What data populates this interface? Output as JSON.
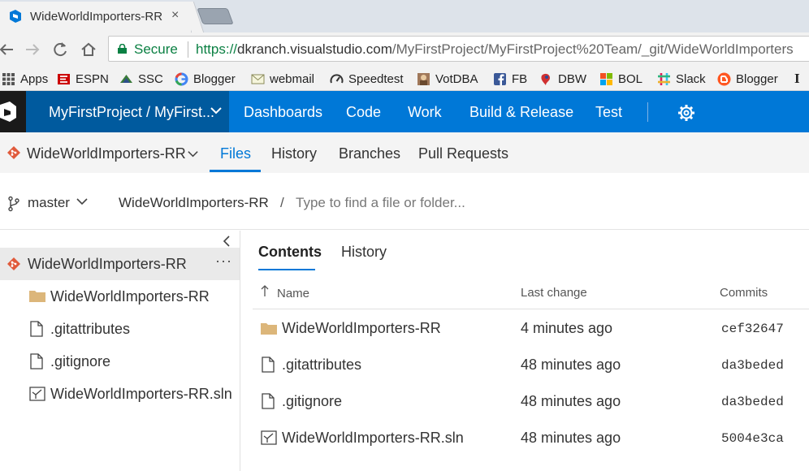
{
  "browser": {
    "tab_title": "WideWorldImporters-RR",
    "tab_close": "×",
    "secure_label": "Secure",
    "url_scheme": "https://",
    "url_host": "dkranch.visualstudio.com",
    "url_path": "/MyFirstProject/MyFirstProject%20Team/_git/WideWorldImporters",
    "bookmarks": [
      {
        "label": "Apps",
        "icon": "apps-grid-icon"
      },
      {
        "label": "ESPN",
        "icon": "espn-icon"
      },
      {
        "label": "SSC",
        "icon": "ssc-icon"
      },
      {
        "label": "Blogger",
        "icon": "google-icon"
      },
      {
        "label": "webmail",
        "icon": "mail-icon"
      },
      {
        "label": "Speedtest",
        "icon": "speedtest-icon"
      },
      {
        "label": "VotDBA",
        "icon": "votdba-icon"
      },
      {
        "label": "FB",
        "icon": "facebook-icon"
      },
      {
        "label": "DBW",
        "icon": "dbw-icon"
      },
      {
        "label": "BOL",
        "icon": "windows-icon"
      },
      {
        "label": "Slack",
        "icon": "slack-icon"
      },
      {
        "label": "Blogger",
        "icon": "blogger-icon"
      }
    ],
    "bookmark_overflow": "I"
  },
  "topnav": {
    "project": "MyFirstProject / MyFirst...",
    "hubs": [
      "Dashboards",
      "Code",
      "Work",
      "Build & Release",
      "Test"
    ],
    "selected_hub": "Code"
  },
  "subnav": {
    "repo": "WideWorldImporters-RR",
    "tabs": [
      "Files",
      "History",
      "Branches",
      "Pull Requests"
    ],
    "active_tab": "Files"
  },
  "pathbar": {
    "branch": "master",
    "repo": "WideWorldImporters-RR",
    "separator": "/",
    "search_placeholder": "Type to find a file or folder..."
  },
  "tree": {
    "root": "WideWorldImporters-RR",
    "more": "···",
    "items": [
      {
        "label": "WideWorldImporters-RR",
        "type": "folder"
      },
      {
        "label": ".gitattributes",
        "type": "file"
      },
      {
        "label": ".gitignore",
        "type": "file"
      },
      {
        "label": "WideWorldImporters-RR.sln",
        "type": "solution"
      }
    ]
  },
  "content": {
    "tabs": [
      "Contents",
      "History"
    ],
    "active_tab": "Contents",
    "columns": {
      "name": "Name",
      "last_change": "Last change",
      "commits": "Commits"
    },
    "rows": [
      {
        "name": "WideWorldImporters-RR",
        "type": "folder",
        "last_change": "4 minutes ago",
        "commit": "cef32647"
      },
      {
        "name": ".gitattributes",
        "type": "file",
        "last_change": "48 minutes ago",
        "commit": "da3beded"
      },
      {
        "name": ".gitignore",
        "type": "file",
        "last_change": "48 minutes ago",
        "commit": "da3beded"
      },
      {
        "name": "WideWorldImporters-RR.sln",
        "type": "solution",
        "last_change": "48 minutes ago",
        "commit": "5004e3ca"
      }
    ]
  },
  "colors": {
    "accent": "#0078d7",
    "nav_dark": "#005a9e",
    "git": "#e05a3b",
    "folder": "#dcb67a"
  }
}
